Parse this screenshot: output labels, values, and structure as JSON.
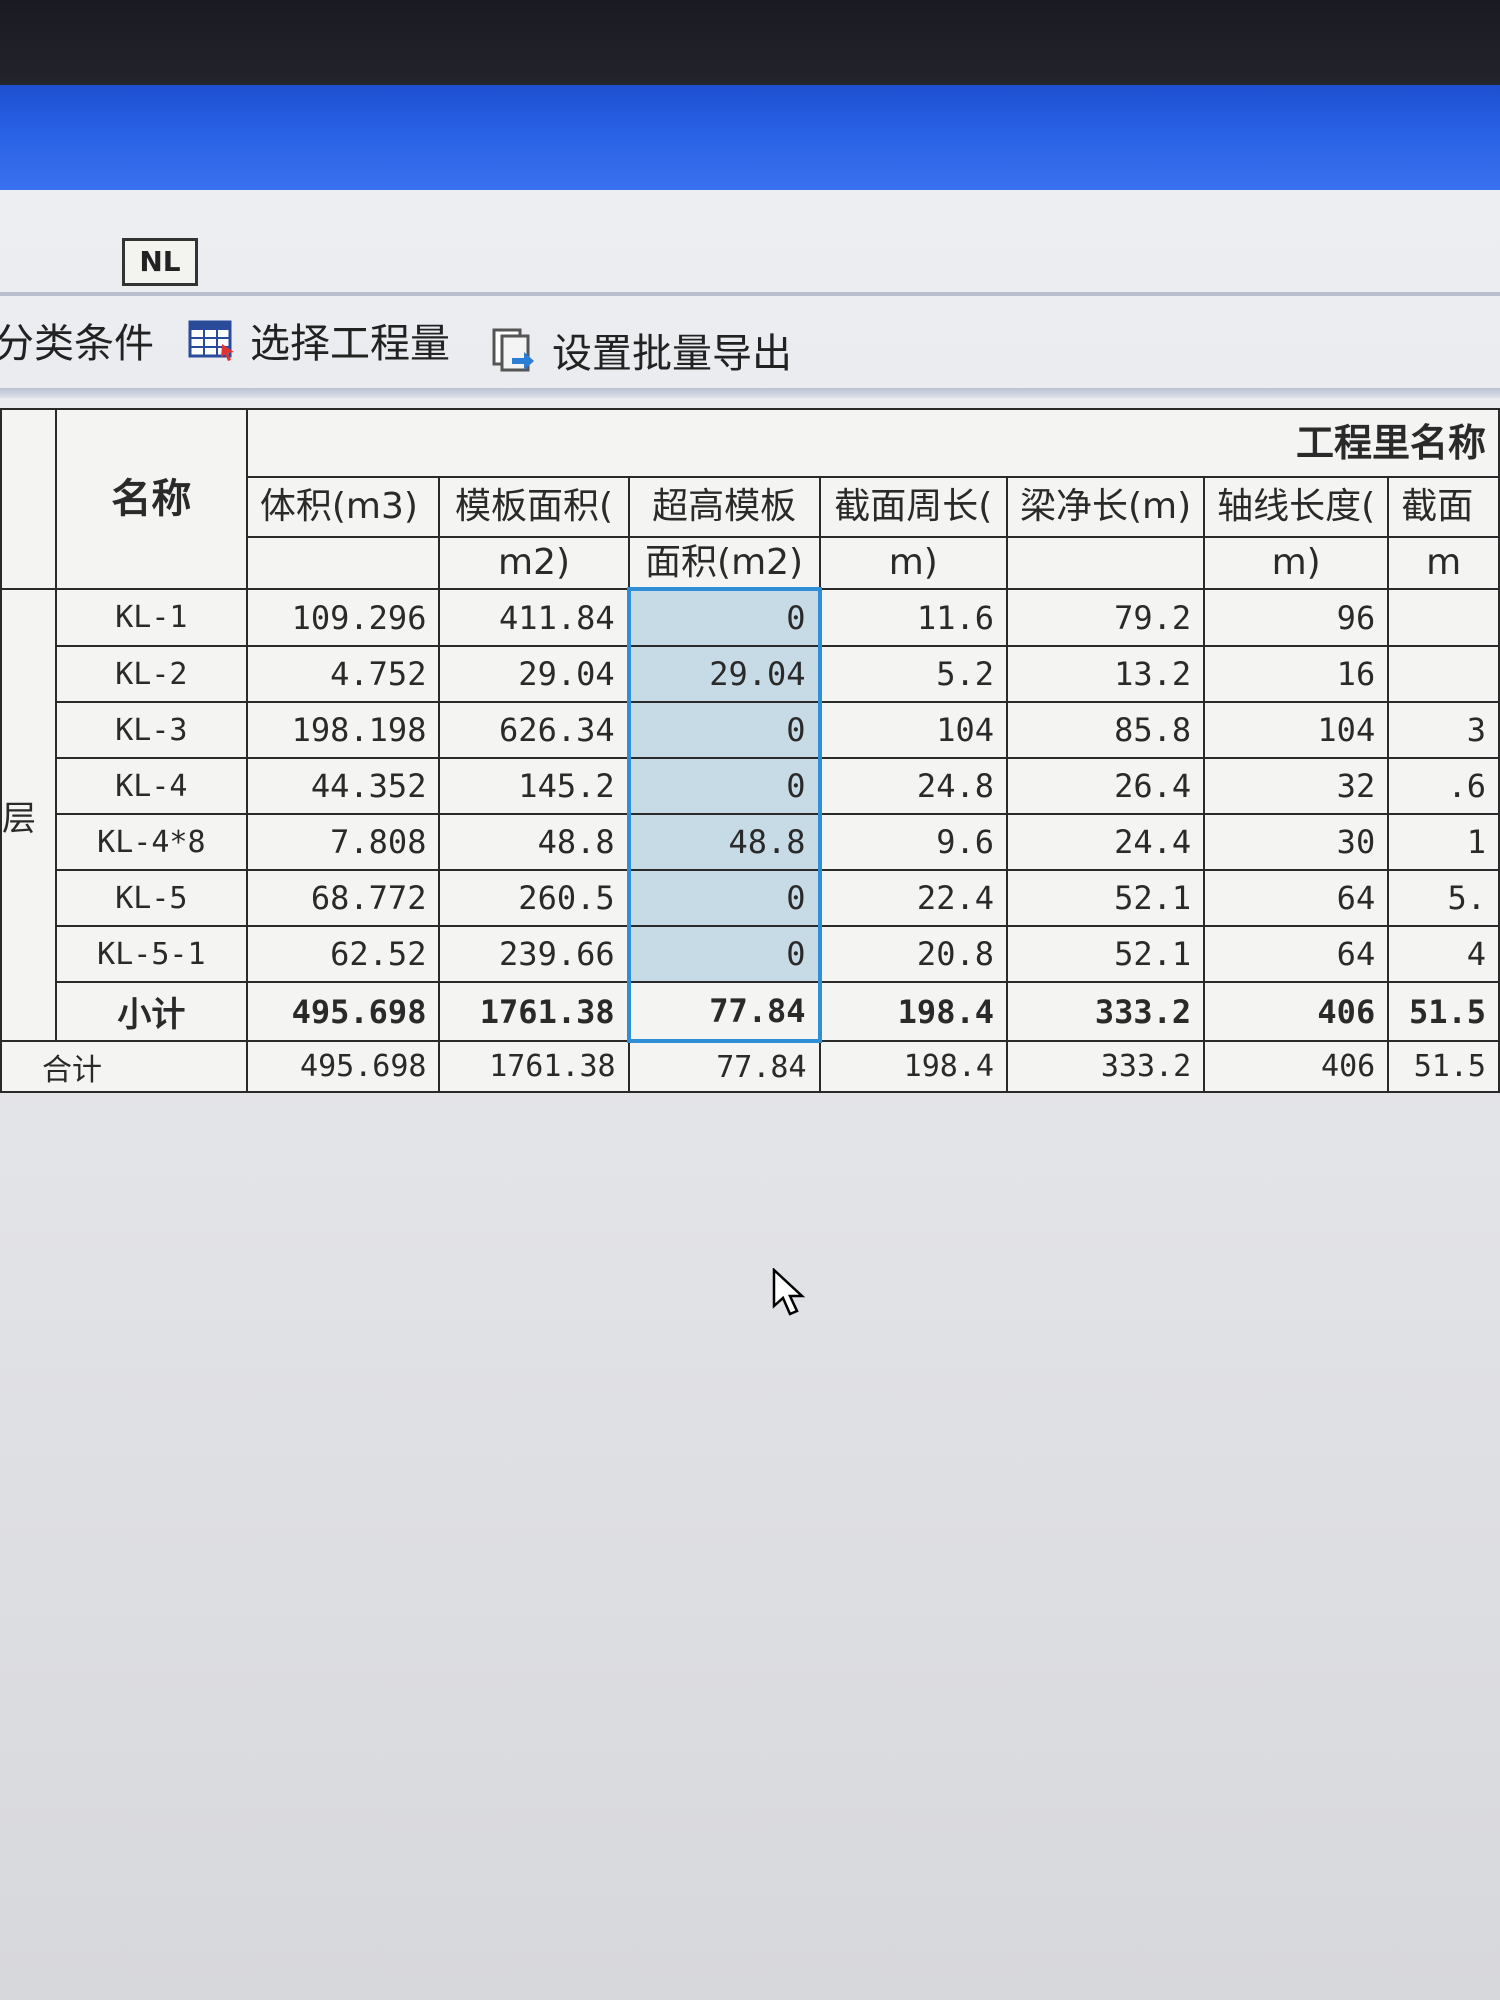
{
  "window": {
    "badge": "NL"
  },
  "toolbar": {
    "items": [
      {
        "label": "分类条件",
        "icon": "filter-icon"
      },
      {
        "label": "选择工程量",
        "icon": "table-select-icon"
      },
      {
        "label": "设置批量导出",
        "icon": "batch-export-icon"
      }
    ]
  },
  "table": {
    "group_header": "工程里名称",
    "name_header": "名称",
    "columns": [
      "体积(m3)",
      "模板面积(m2)",
      "超高模板面积(m2)",
      "截面周长(m)",
      "梁净长(m)",
      "轴线长度(m)",
      "截面"
    ],
    "column_lines": [
      [
        "体积(m3)"
      ],
      [
        "模板面积(",
        "m2)"
      ],
      [
        "超高模板",
        "面积(m2)"
      ],
      [
        "截面周长(",
        "m)"
      ],
      [
        "梁净长(m)"
      ],
      [
        "轴线长度(",
        "m)"
      ],
      [
        "截面",
        "m"
      ]
    ],
    "floor_label": "层",
    "rows": [
      {
        "name": "KL-1",
        "values": [
          "109.296",
          "411.84",
          "0",
          "11.6",
          "79.2",
          "96",
          ""
        ]
      },
      {
        "name": "KL-2",
        "values": [
          "4.752",
          "29.04",
          "29.04",
          "5.2",
          "13.2",
          "16",
          ""
        ]
      },
      {
        "name": "KL-3",
        "values": [
          "198.198",
          "626.34",
          "0",
          "104",
          "85.8",
          "104",
          "3"
        ]
      },
      {
        "name": "KL-4",
        "values": [
          "44.352",
          "145.2",
          "0",
          "24.8",
          "26.4",
          "32",
          ".6"
        ]
      },
      {
        "name": "KL-4*8",
        "values": [
          "7.808",
          "48.8",
          "48.8",
          "9.6",
          "24.4",
          "30",
          "1"
        ]
      },
      {
        "name": "KL-5",
        "values": [
          "68.772",
          "260.5",
          "0",
          "22.4",
          "52.1",
          "64",
          "5."
        ]
      },
      {
        "name": "KL-5-1",
        "values": [
          "62.52",
          "239.66",
          "0",
          "20.8",
          "52.1",
          "64",
          "4"
        ]
      }
    ],
    "subtotal": {
      "label": "小计",
      "values": [
        "495.698",
        "1761.38",
        "77.84",
        "198.4",
        "333.2",
        "406",
        "51.5"
      ]
    },
    "total": {
      "label": "合计",
      "values": [
        "495.698",
        "1761.38",
        "77.84",
        "198.4",
        "333.2",
        "406",
        "51.5"
      ]
    }
  },
  "colors": {
    "titlebar": "#2a62e6",
    "selection_border": "#2e8fd6",
    "selection_fill": "#c7dbe6"
  }
}
